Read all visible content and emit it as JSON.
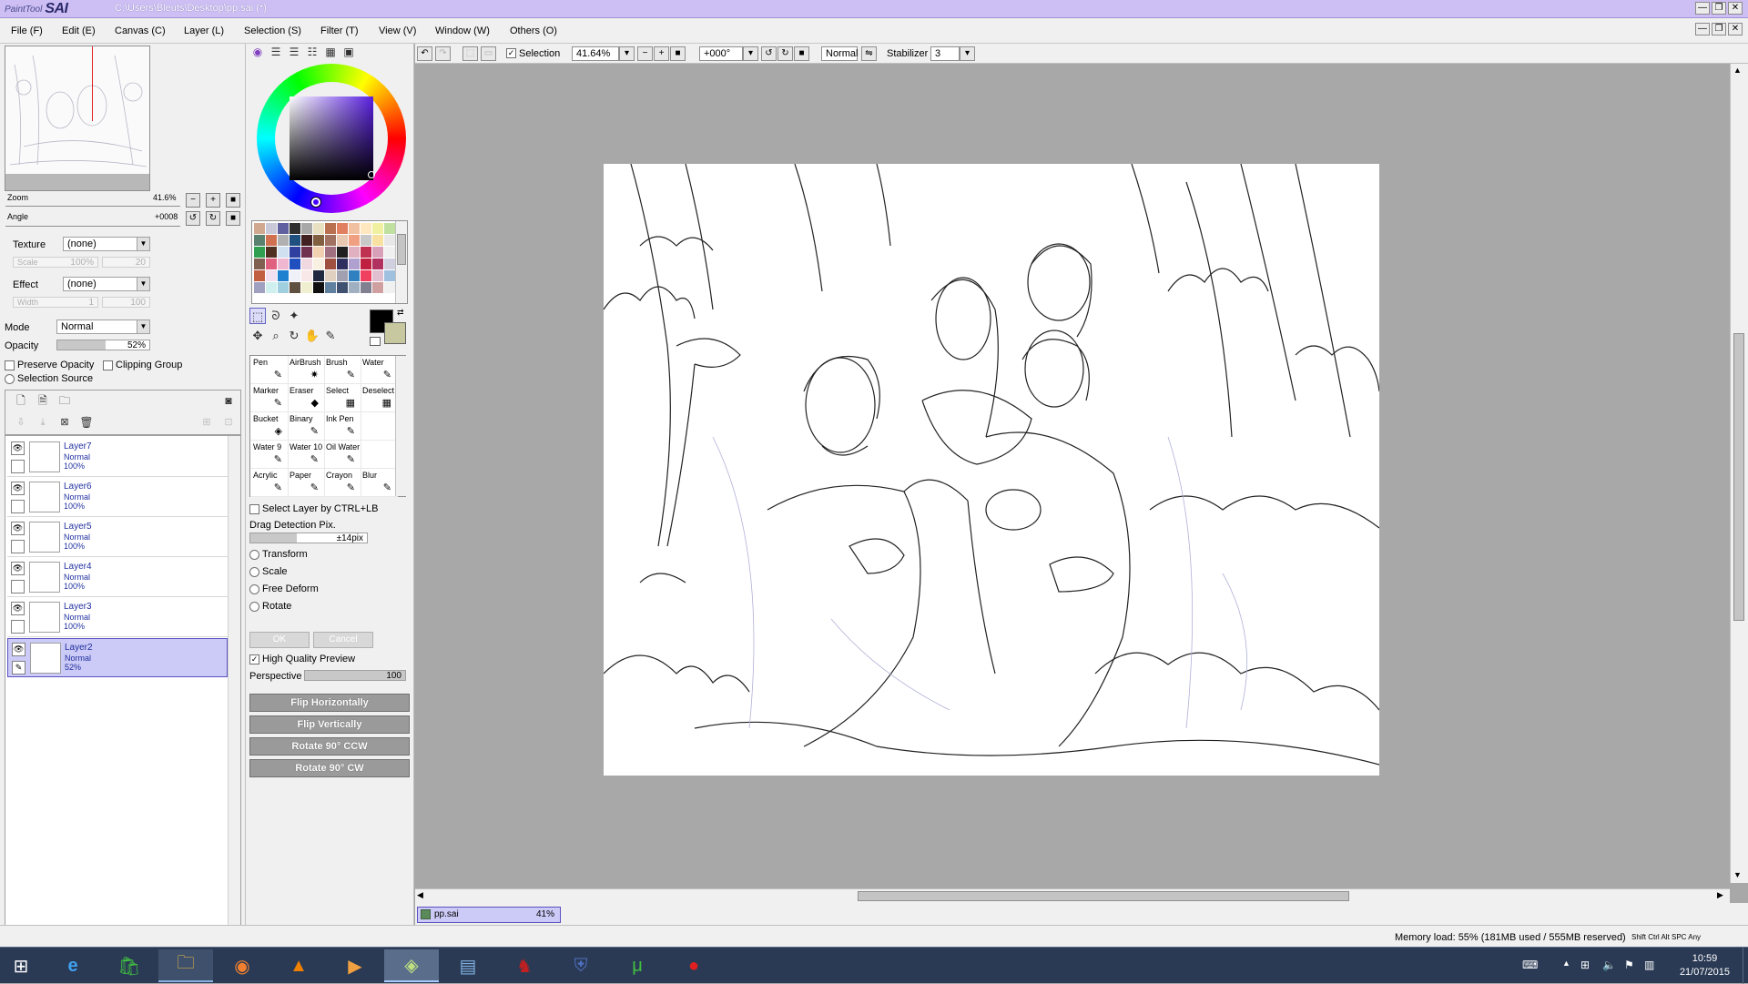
{
  "titlebar": {
    "logo_small": "PaintTool",
    "logo_big": "SAI",
    "path": "C:\\Users\\Bleuts\\Desktop\\pp.sai (*)",
    "min": "—",
    "max": "❐",
    "close": "✕"
  },
  "menu": {
    "items": [
      "File (F)",
      "Edit (E)",
      "Canvas (C)",
      "Layer (L)",
      "Selection (S)",
      "Filter (T)",
      "View (V)",
      "Window (W)",
      "Others (O)"
    ]
  },
  "navigator": {
    "zoom_label": "Zoom",
    "zoom_value": "41.6%",
    "angle_label": "Angle",
    "angle_value": "+0008",
    "btn_minus": "−",
    "btn_plus": "+",
    "btn_reset": "■",
    "btn_rotl": "↺",
    "btn_rotr": "↻",
    "btn_rotreset": "■"
  },
  "layer_props": {
    "texture_label": "Texture",
    "texture_value": "(none)",
    "scale_label": "Scale",
    "scale_value": "100%",
    "scale_value2": "20",
    "effect_label": "Effect",
    "effect_value": "(none)",
    "width_label": "Width",
    "width_value": "1",
    "width_value2": "100",
    "mode_label": "Mode",
    "mode_value": "Normal",
    "opacity_label": "Opacity",
    "opacity_value": "52%",
    "opacity_fraction": 0.52,
    "preserve_opacity": "Preserve Opacity",
    "clipping_group": "Clipping Group",
    "selection_source": "Selection Source"
  },
  "layers": [
    {
      "name": "Layer7",
      "mode": "Normal",
      "opacity": "100%",
      "active": false
    },
    {
      "name": "Layer6",
      "mode": "Normal",
      "opacity": "100%",
      "active": false
    },
    {
      "name": "Layer5",
      "mode": "Normal",
      "opacity": "100%",
      "active": false
    },
    {
      "name": "Layer4",
      "mode": "Normal",
      "opacity": "100%",
      "active": false
    },
    {
      "name": "Layer3",
      "mode": "Normal",
      "opacity": "100%",
      "active": false
    },
    {
      "name": "Layer2",
      "mode": "Normal",
      "opacity": "52%",
      "active": true
    }
  ],
  "swatch_colors": [
    "#d0a890",
    "#c8c8d8",
    "#6060a0",
    "#303030",
    "#a8a8a8",
    "#e8e0c0",
    "#b87050",
    "#e08060",
    "#f0c0a0",
    "#ffe8c0",
    "#f0f0a0",
    "#c0e0a0",
    "#5a8070",
    "#d07050",
    "#b0b0b0",
    "#205080",
    "#402020",
    "#806040",
    "#a07060",
    "#e8c8b0",
    "#f0a080",
    "#c8c8c8",
    "#f8e0a0",
    "#e8e8e8",
    "#30a050",
    "#503020",
    "#d0e0f0",
    "#3040a0",
    "#703050",
    "#f0d0b0",
    "#a07080",
    "#202020",
    "#e0b0c0",
    "#c03050",
    "#d8a0b8",
    "#f0f0f0",
    "#806050",
    "#e06080",
    "#f0b8d0",
    "#2050c0",
    "#f0d8e0",
    "#f8f0e0",
    "#a05040",
    "#303060",
    "#b0a0d0",
    "#c02040",
    "#b03060",
    "#d0d0e0",
    "#c06040",
    "#f0e0f0",
    "#2080d0",
    "#f0f0f8",
    "#f8e8e8",
    "#202840",
    "#e0d0c0",
    "#a0a0b0",
    "#3080c0",
    "#f04060",
    "#e0c0d0",
    "#a0c0e0",
    "#a0a0c0",
    "#d0f0f0",
    "#a0d0e0",
    "#605040",
    "#f0f0d0",
    "#101010",
    "#6080a0",
    "#405070",
    "#a0b0c0",
    "#808090",
    "#d0a0a0",
    "#f0f0f0"
  ],
  "tools": {
    "select_rect": "⬚",
    "lasso": "ᘐ",
    "wand": "✦",
    "move": "✥",
    "zoom": "⌕",
    "rotate": "↻",
    "hand": "✋",
    "eyedropper": "✎"
  },
  "brushes": [
    {
      "name": "Pen",
      "icon": "✎"
    },
    {
      "name": "AirBrush",
      "icon": "✷"
    },
    {
      "name": "Brush",
      "icon": "✎"
    },
    {
      "name": "Water",
      "icon": "✎"
    },
    {
      "name": "Marker",
      "icon": "✎"
    },
    {
      "name": "Eraser",
      "icon": "◆"
    },
    {
      "name": "Select",
      "icon": "▦"
    },
    {
      "name": "Deselect",
      "icon": "▦"
    },
    {
      "name": "Bucket",
      "icon": "◈"
    },
    {
      "name": "Binary",
      "icon": "✎"
    },
    {
      "name": "Ink Pen",
      "icon": "✎"
    },
    {
      "name": "",
      "icon": ""
    },
    {
      "name": "Water 9",
      "icon": "✎"
    },
    {
      "name": "Water 10",
      "icon": "✎"
    },
    {
      "name": "Oil Water",
      "icon": "✎"
    },
    {
      "name": "",
      "icon": ""
    },
    {
      "name": "Acrylic",
      "icon": "✎"
    },
    {
      "name": "Paper",
      "icon": "✎"
    },
    {
      "name": "Crayon",
      "icon": "✎"
    },
    {
      "name": "Blur",
      "icon": "✎"
    }
  ],
  "transform_panel": {
    "select_layer": "Select Layer by CTRL+LB",
    "drag_detection": "Drag Detection Pix.",
    "drag_value": "±14pix",
    "transform": "Transform",
    "scale": "Scale",
    "free_deform": "Free Deform",
    "rotate": "Rotate",
    "ok": "OK",
    "cancel": "Cancel",
    "high_quality": "High Quality Preview",
    "perspective_label": "Perspective",
    "perspective_value": "100",
    "flip_h": "Flip Horizontally",
    "flip_v": "Flip Vertically",
    "rot_ccw": "Rotate 90° CCW",
    "rot_cw": "Rotate 90° CW"
  },
  "canvas_toolbar": {
    "selection_label": "Selection",
    "zoom_value": "41.64%",
    "angle_value": "+000°",
    "blend_value": "Normal",
    "stabilizer_label": "Stabilizer",
    "stabilizer_value": "3"
  },
  "doc_tab": {
    "name": "pp.sai",
    "zoom": "41%"
  },
  "status": {
    "memory": "Memory load: 55% (181MB used / 555MB reserved)",
    "keys": "Shift Ctrl Alt SPC Any"
  },
  "taskbar": {
    "time": "10:59",
    "date": "21/07/2015"
  }
}
